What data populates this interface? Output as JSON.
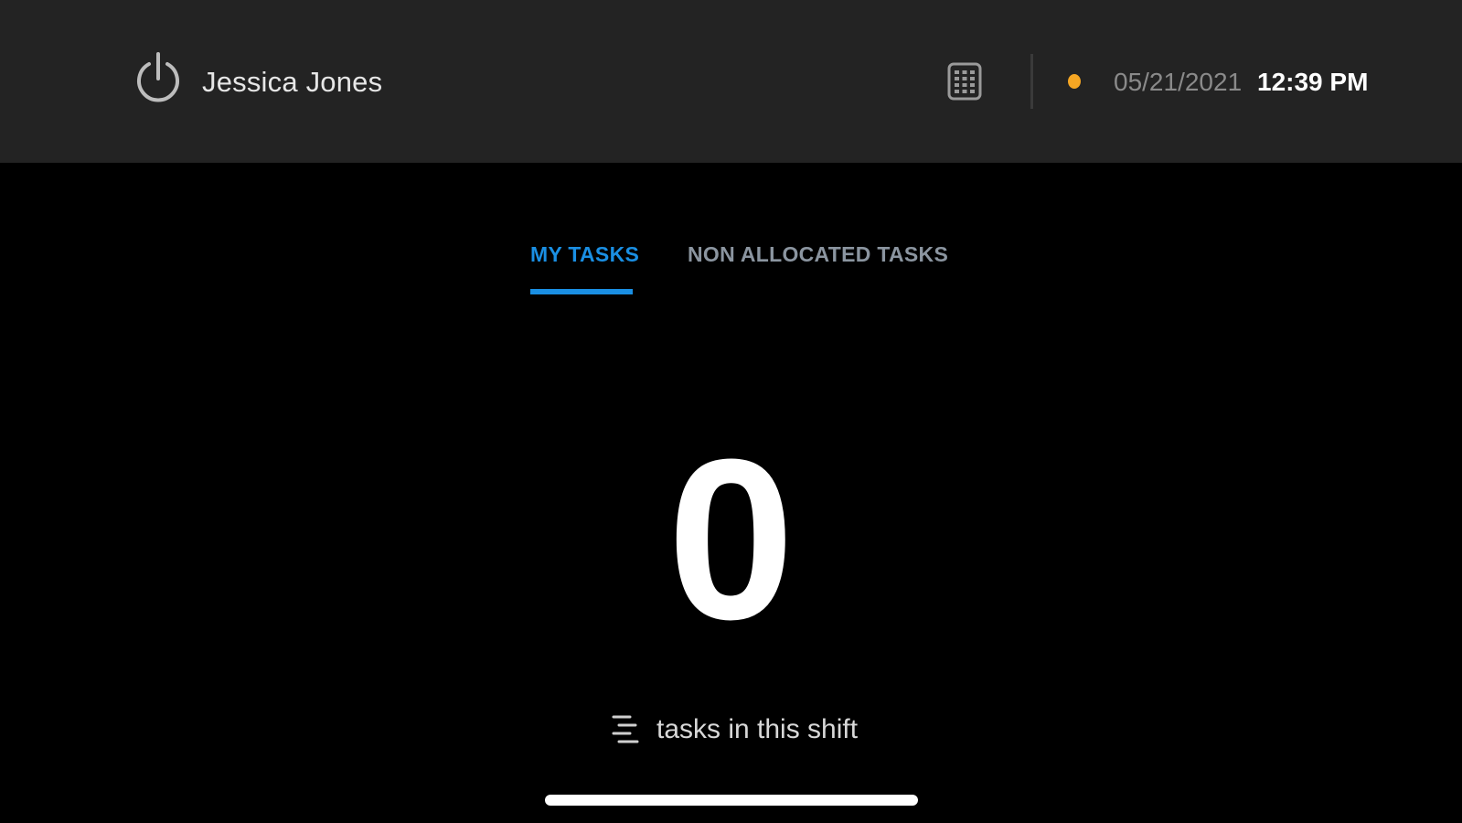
{
  "header": {
    "user_name": "Jessica Jones",
    "date": "05/21/2021",
    "time": "12:39 PM",
    "status_color": "#f5a623",
    "icons": {
      "power": "power-icon",
      "calendar": "calendar-icon"
    }
  },
  "tabs": [
    {
      "label": "MY TASKS",
      "active": true
    },
    {
      "label": "NON ALLOCATED TASKS",
      "active": false
    }
  ],
  "summary": {
    "count": "0",
    "caption": "tasks in this shift",
    "icon": "list-icon"
  },
  "colors": {
    "accent": "#1a8fe3",
    "header_bg": "#232323",
    "background": "#000000"
  }
}
